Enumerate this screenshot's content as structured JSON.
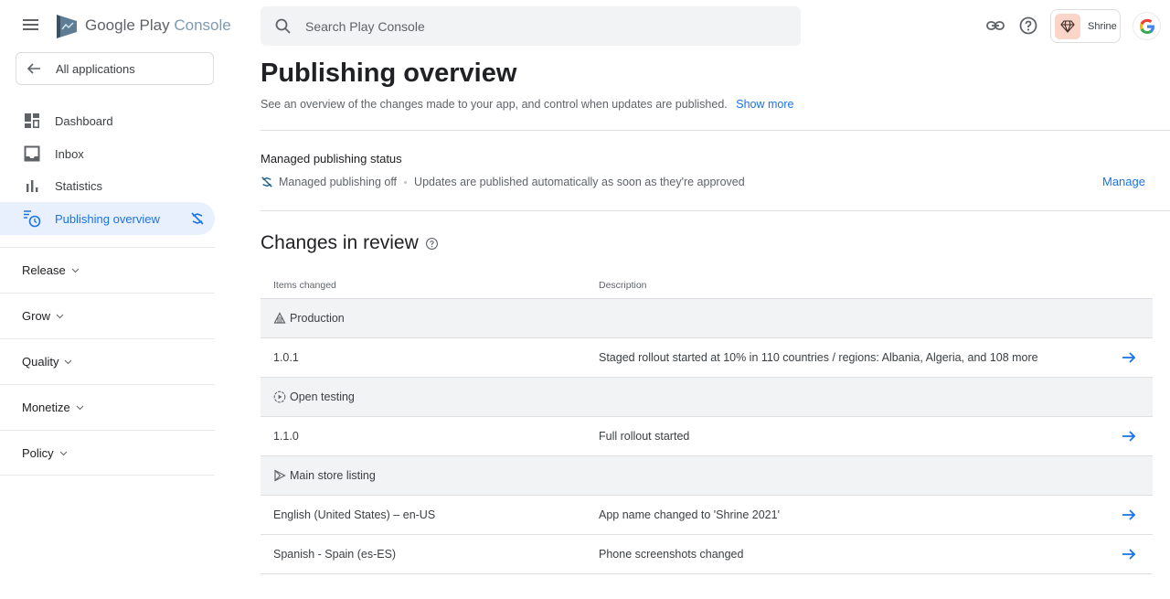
{
  "brand": {
    "name_main": "Google Play ",
    "name_accent": "Console"
  },
  "sidebar": {
    "back_label": "All applications",
    "items": [
      {
        "label": "Dashboard",
        "icon": "dashboard-icon"
      },
      {
        "label": "Inbox",
        "icon": "inbox-icon"
      },
      {
        "label": "Statistics",
        "icon": "statistics-icon"
      },
      {
        "label": "Publishing overview",
        "icon": "publishing-overview-icon",
        "active": true,
        "trailing_icon": "managed-publishing-off-icon"
      }
    ],
    "sections": [
      {
        "label": "Release"
      },
      {
        "label": "Grow"
      },
      {
        "label": "Quality"
      },
      {
        "label": "Monetize"
      },
      {
        "label": "Policy"
      }
    ]
  },
  "topbar": {
    "search_placeholder": "Search Play Console",
    "app_name": "Shrine"
  },
  "page": {
    "title": "Publishing overview",
    "description": "See an overview of the changes made to your app, and control when updates are published.",
    "show_more": "Show more"
  },
  "managed_publishing": {
    "title": "Managed publishing status",
    "status": "Managed publishing off",
    "detail": "Updates are published automatically as soon as they're approved",
    "manage_label": "Manage"
  },
  "changes": {
    "title": "Changes in review",
    "columns": [
      "Items changed",
      "Description"
    ],
    "groups": [
      {
        "name": "Production",
        "icon": "production-icon",
        "rows": [
          {
            "item": "1.0.1",
            "description": "Staged rollout started at 10% in 110 countries / regions: Albania, Algeria, and 108 more"
          }
        ]
      },
      {
        "name": "Open testing",
        "icon": "open-testing-icon",
        "rows": [
          {
            "item": "1.1.0",
            "description": "Full rollout started"
          }
        ]
      },
      {
        "name": "Main store listing",
        "icon": "store-listing-icon",
        "rows": [
          {
            "item": "English (United States) – en-US",
            "description": "App name changed to 'Shrine 2021'"
          },
          {
            "item": "Spanish - Spain (es-ES)",
            "description": "Phone screenshots changed"
          }
        ]
      }
    ]
  },
  "colors": {
    "accent": "#1a73e8",
    "active_bg": "#e8f0fe",
    "group_bg": "#f1f3f4"
  }
}
